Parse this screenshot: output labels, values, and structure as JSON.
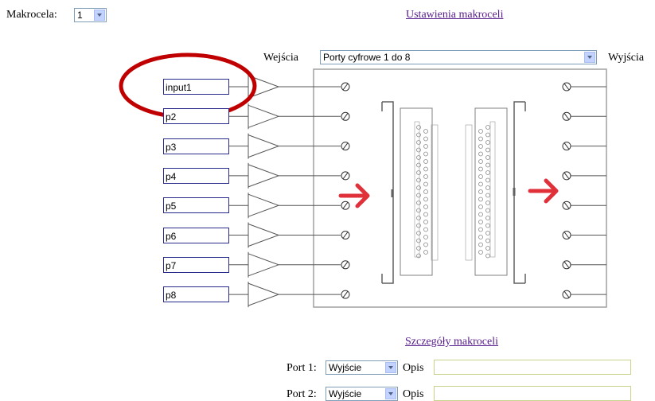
{
  "macro": {
    "label": "Makrocela:",
    "selected": "1"
  },
  "links": {
    "settings": "Ustawienia makroceli",
    "details": "Szczegóły makroceli"
  },
  "diagram": {
    "inputs_label": "Wejścia",
    "outputs_label": "Wyjścia",
    "port_range_selected": "Porty cyfrowe 1 do 8",
    "inputs": [
      "input1",
      "p2",
      "p3",
      "p4",
      "p5",
      "p6",
      "p7",
      "p8"
    ]
  },
  "ports": [
    {
      "label": "Port 1:",
      "direction": "Wyjście",
      "desc_label": "Opis",
      "desc_value": ""
    },
    {
      "label": "Port 2:",
      "direction": "Wyjście",
      "desc_label": "Opis",
      "desc_value": ""
    }
  ],
  "colors": {
    "link": "#551a8b",
    "annotation": "#c00000",
    "arrow": "#e0303a",
    "desc_border": "#c8d28a"
  }
}
